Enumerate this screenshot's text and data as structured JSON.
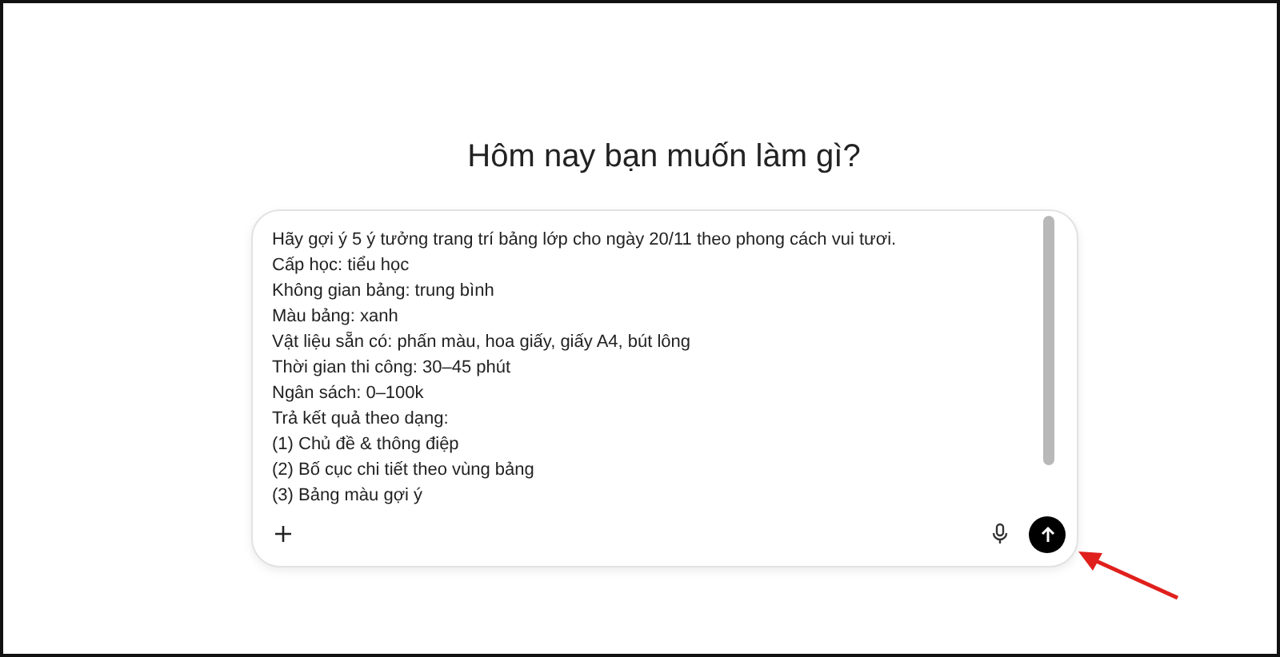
{
  "heading": "Hôm nay bạn muốn làm gì?",
  "composer": {
    "lines": [
      "Hãy gợi ý 5 ý tưởng trang trí bảng lớp cho ngày 20/11 theo phong cách vui tươi.",
      "Cấp học: tiểu học",
      "Không gian bảng: trung bình",
      "Màu bảng: xanh",
      "Vật liệu sẵn có: phấn màu, hoa giấy, giấy A4, bút lông",
      "Thời gian thi công: 30–45 phút",
      "Ngân sách: 0–100k",
      "Trả kết quả theo dạng:",
      "(1) Chủ đề & thông điệp",
      "(2) Bố cục chi tiết theo vùng bảng",
      "(3) Bảng màu gợi ý"
    ]
  }
}
